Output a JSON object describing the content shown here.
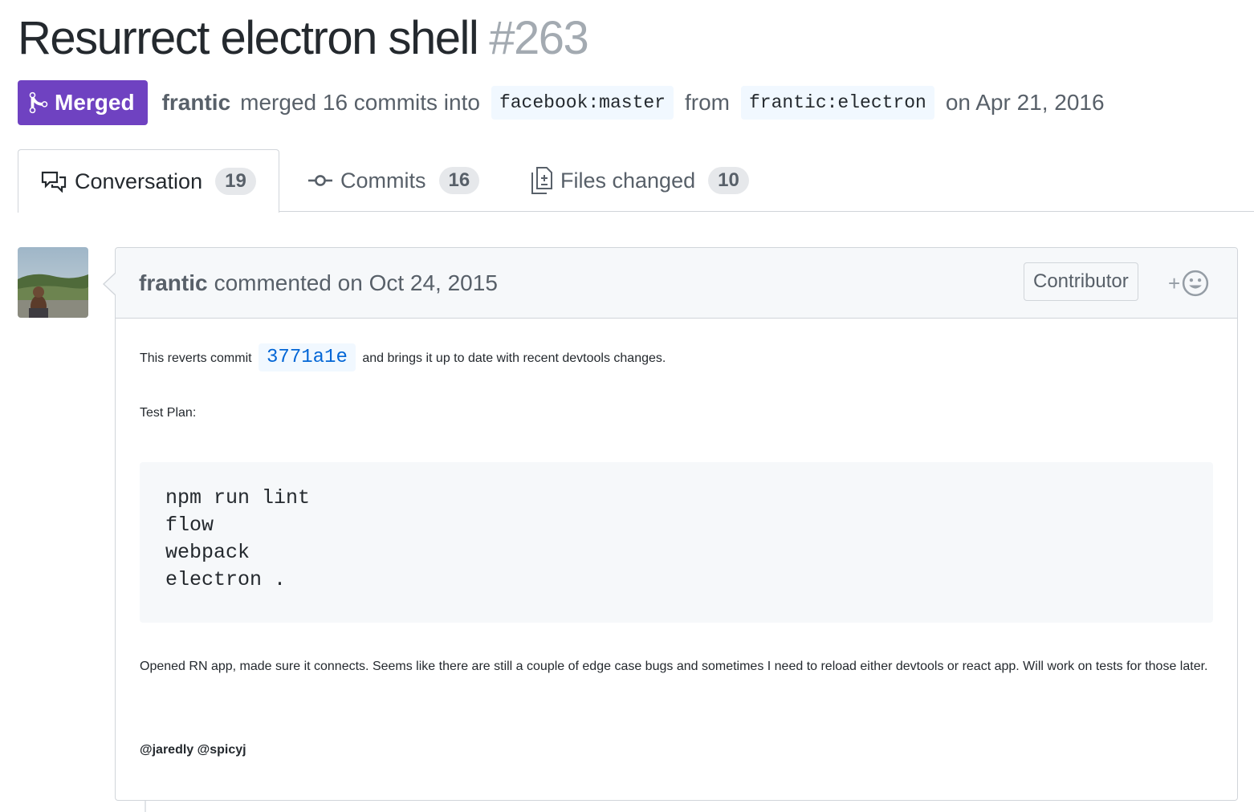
{
  "pr": {
    "title": "Resurrect electron shell",
    "number": "#263",
    "state": "Merged",
    "author": "frantic",
    "merge_text": "merged 16 commits into",
    "base_branch": "facebook:master",
    "from_text": "from",
    "head_branch": "frantic:electron",
    "date_text": "on Apr 21, 2016"
  },
  "tabs": [
    {
      "label": "Conversation",
      "count": "19",
      "icon": "comment-discussion-icon"
    },
    {
      "label": "Commits",
      "count": "16",
      "icon": "git-commit-icon"
    },
    {
      "label": "Files changed",
      "count": "10",
      "icon": "diff-icon"
    }
  ],
  "comment": {
    "author": "frantic",
    "action": "commented on Oct 24, 2015",
    "role": "Contributor",
    "reaction_plus": "+",
    "body": {
      "p1_before": "This reverts commit",
      "commit_sha": "3771a1e",
      "p1_after": "and brings it up to date with recent devtools changes.",
      "p2": "Test Plan:",
      "code": "npm run lint\nflow\nwebpack\nelectron .",
      "p3": "Opened RN app, made sure it connects. Seems like there are still a couple of edge case bugs and sometimes I need to reload either devtools or react app. Will work on tests for those later.",
      "mention1": "@jaredly",
      "mention2": "@spicyj"
    }
  },
  "colors": {
    "merged": "#6f42c1",
    "link": "#0366d6",
    "muted": "#586069"
  }
}
